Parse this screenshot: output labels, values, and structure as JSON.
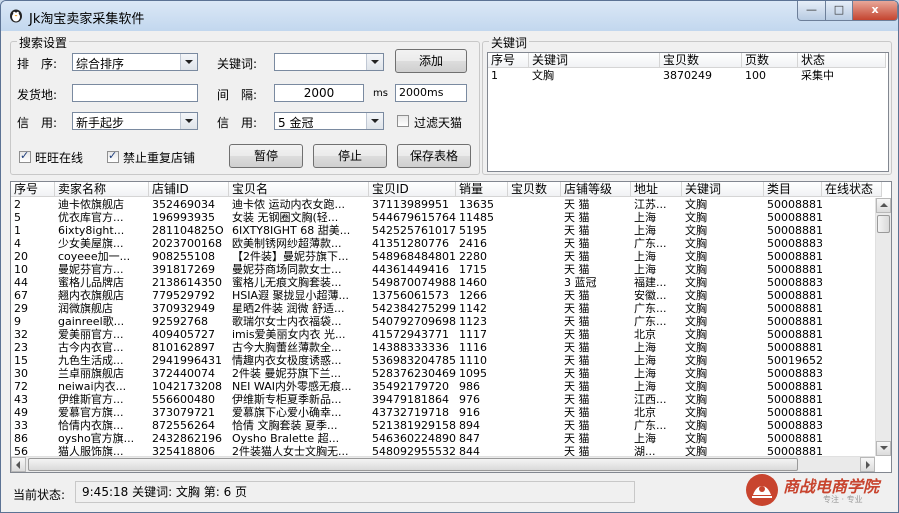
{
  "window": {
    "title": "Jk淘宝卖家采集软件",
    "min_label": "—",
    "max_label": "□",
    "close_label": "x"
  },
  "search": {
    "group_title": "搜索设置",
    "sort_label": "排　序:",
    "sort_value": "综合排序",
    "keyword_label": "关键词:",
    "keyword_value": "",
    "add_button": "添加",
    "location_label": "发货地:",
    "location_value": "",
    "interval_label": "间　隔:",
    "interval_value": "2000",
    "interval_unit": "ms",
    "interval_display": "2000ms",
    "credit_label": "信　用:",
    "credit_from": "新手起步",
    "credit2_label": "信　用:",
    "credit_to": "5 金冠",
    "filter_tmall_label": "过滤天猫",
    "filter_tmall_checked": false,
    "wangwang_label": "旺旺在线",
    "wangwang_checked": true,
    "no_dup_label": "禁止重复店铺",
    "no_dup_checked": true,
    "pause_button": "暂停",
    "stop_button": "停止",
    "save_button": "保存表格"
  },
  "keywords": {
    "group_title": "关键词",
    "columns": [
      "序号",
      "关键词",
      "宝贝数",
      "页数",
      "状态"
    ],
    "rows": [
      [
        "1",
        "文胸",
        "3870249",
        "100",
        "采集中"
      ]
    ]
  },
  "results": {
    "columns": [
      "序号",
      "卖家名称",
      "店铺ID",
      "宝贝名",
      "宝贝ID",
      "销量",
      "宝贝数",
      "店铺等级",
      "地址",
      "关键词",
      "类目",
      "在线状态"
    ],
    "rows": [
      [
        "2",
        "迪卡侬旗舰店",
        "352469034",
        "迪卡侬 运动内衣女跑...",
        "37113989951",
        "13635",
        "",
        "天 猫",
        "江苏...",
        "文胸",
        "50008881",
        ""
      ],
      [
        "5",
        "优衣库官方...",
        "196993935",
        "女装 无钢圈文胸(轻...",
        "544679615764",
        "11485",
        "",
        "天 猫",
        "上海",
        "文胸",
        "50008881",
        ""
      ],
      [
        "1",
        "6ixty8ight...",
        "281104825O",
        "6IXTY8IGHT 68 甜美...",
        "542525761017",
        "5195",
        "",
        "天 猫",
        "上海",
        "文胸",
        "50008881",
        ""
      ],
      [
        "4",
        "少女美屋旗...",
        "2023700168",
        "欧美制锈网纱超薄款...",
        "41351280776",
        "2416",
        "",
        "天 猫",
        "广东...",
        "文胸",
        "50008883",
        ""
      ],
      [
        "20",
        "coyeee加一...",
        "908255108",
        "【2件装】曼妮芬旗下...",
        "548968484801",
        "2280",
        "",
        "天 猫",
        "上海",
        "文胸",
        "50008881",
        ""
      ],
      [
        "10",
        "曼妮芬官方...",
        "391817269",
        "曼妮芬商场同款女士...",
        "44361449416",
        "1715",
        "",
        "天 猫",
        "上海",
        "文胸",
        "50008881",
        ""
      ],
      [
        "44",
        "蜜格儿品牌店",
        "2138614350",
        "蜜格儿无痕文胸套装...",
        "549870074988",
        "1460",
        "",
        "3 蓝冠",
        "福建...",
        "文胸",
        "50008883",
        ""
      ],
      [
        "67",
        "翘内衣旗舰店",
        "779529792",
        "HSIA遐 聚拢显小超薄...",
        "13756061573",
        "1266",
        "",
        "天 猫",
        "安徽...",
        "文胸",
        "50008881",
        ""
      ],
      [
        "29",
        "润微旗舰店",
        "370932949",
        "星晒2件装 润微 舒适...",
        "542384275299",
        "1142",
        "",
        "天 猫",
        "广东...",
        "文胸",
        "50008881",
        ""
      ],
      [
        "9",
        "gainreel歌...",
        "92592768",
        "歌瑞尔女士内衣福袋...",
        "540792709698",
        "1123",
        "",
        "天 猫",
        "广东...",
        "文胸",
        "50008881",
        ""
      ],
      [
        "32",
        "爱美丽官方...",
        "409405727",
        "imis爱美丽女内衣 光...",
        "41572943771",
        "1117",
        "",
        "天 猫",
        "北京",
        "文胸",
        "50008881",
        ""
      ],
      [
        "23",
        "古今内衣官...",
        "810162897",
        "古今大胸蕾丝薄款全...",
        "14388333336",
        "1116",
        "",
        "天 猫",
        "上海",
        "文胸",
        "50008881",
        ""
      ],
      [
        "15",
        "九色生活成...",
        "2941996431",
        "情趣内衣女极度诱惑...",
        "536983204785",
        "1110",
        "",
        "天 猫",
        "上海",
        "文胸",
        "50019652",
        ""
      ],
      [
        "30",
        "兰卓丽旗舰店",
        "372440074",
        "2件装 曼妮芬旗下兰...",
        "528376230469",
        "1095",
        "",
        "天 猫",
        "上海",
        "文胸",
        "50008883",
        ""
      ],
      [
        "72",
        "neiwai内衣...",
        "1042173208",
        "NEI WAI内外零感无痕...",
        "35492179720",
        "986",
        "",
        "天 猫",
        "上海",
        "文胸",
        "50008881",
        ""
      ],
      [
        "43",
        "伊维斯官方...",
        "556600480",
        "伊维斯专柜夏季新品...",
        "39479181864",
        "976",
        "",
        "天 猫",
        "江西...",
        "文胸",
        "50008881",
        ""
      ],
      [
        "49",
        "爱慕官方旗...",
        "373079721",
        "爱慕旗下心爱小确幸...",
        "43732719718",
        "916",
        "",
        "天 猫",
        "北京",
        "文胸",
        "50008881",
        ""
      ],
      [
        "33",
        "恰倩内衣旗...",
        "872556264",
        "恰倩 文胸套装 夏季...",
        "521381929158",
        "894",
        "",
        "天 猫",
        "广东...",
        "文胸",
        "50008883",
        ""
      ],
      [
        "86",
        "oysho官方旗...",
        "2432862196",
        "Oysho Bralette 超...",
        "546360224890",
        "847",
        "",
        "天 猫",
        "上海",
        "文胸",
        "50008881",
        ""
      ],
      [
        "56",
        "猫人服饰旗...",
        "325418806",
        "2件装猫人女士文胸无...",
        "548092955532",
        "844",
        "",
        "天 猫",
        "湖...",
        "文胸",
        "50008881",
        ""
      ]
    ]
  },
  "status": {
    "label": "当前状态:",
    "text": "9:45:18 关键词: 文胸 第: 6 页"
  },
  "logo": {
    "name": "商战电商学院",
    "slogan": "专注 · 专业"
  },
  "colors": {
    "logo_red": "#c8442e",
    "title_bg": "#c2d7ee"
  }
}
